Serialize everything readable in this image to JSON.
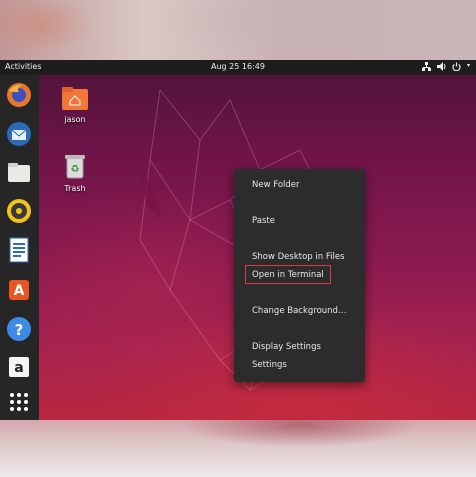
{
  "topbar": {
    "activities": "Activities",
    "clock": "Aug 25  16:49",
    "tray_icons": [
      "network-icon",
      "volume-icon",
      "power-icon"
    ]
  },
  "dock": {
    "items": [
      {
        "name": "firefox-icon"
      },
      {
        "name": "thunderbird-icon"
      },
      {
        "name": "files-icon"
      },
      {
        "name": "rhythmbox-icon"
      },
      {
        "name": "libreoffice-writer-icon"
      },
      {
        "name": "ubuntu-software-icon"
      },
      {
        "name": "help-icon"
      },
      {
        "name": "amazon-icon"
      },
      {
        "name": "show-applications-icon"
      }
    ]
  },
  "desktop": {
    "icons": [
      {
        "label": "jason",
        "icon": "home-folder-icon"
      },
      {
        "label": "Trash",
        "icon": "trash-icon"
      }
    ]
  },
  "context_menu": {
    "items": [
      {
        "label": "New Folder"
      },
      {
        "label": "Paste"
      },
      {
        "label": "Show Desktop in Files"
      },
      {
        "label": "Open in Terminal",
        "highlighted": true
      },
      {
        "label": "Change Background…"
      },
      {
        "label": "Display Settings"
      },
      {
        "label": "Settings"
      }
    ],
    "highlight_color": "#d93a45"
  },
  "colors": {
    "topbar_bg": "#1d1d1d",
    "dock_bg": "#262626",
    "menu_bg": "#2c2c2c",
    "folder_orange": "#f0763a"
  }
}
